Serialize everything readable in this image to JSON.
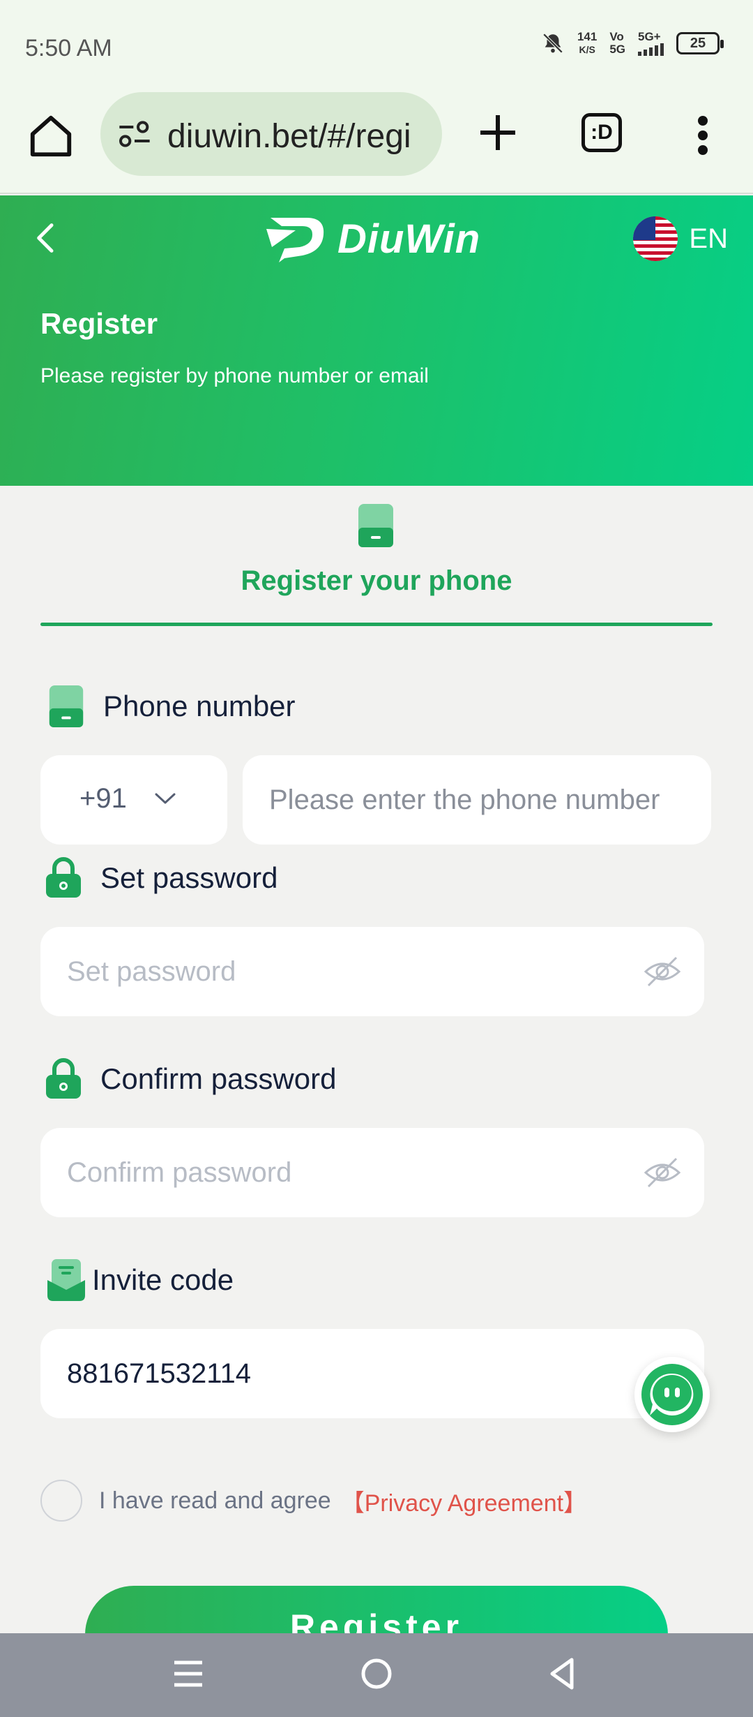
{
  "status_bar": {
    "time": "5:50 AM",
    "net_speed_value": "141",
    "net_speed_unit": "K/S",
    "signal_top": "Vo",
    "signal_bottom": "5G",
    "network_type": "5G+",
    "battery": "25"
  },
  "browser": {
    "url": "diuwin.bet/#/regi",
    "tabs_label": ":D"
  },
  "header": {
    "brand": "DiuWin",
    "language": "EN",
    "title": "Register",
    "subtitle": "Please register by phone number or email"
  },
  "tab": {
    "label": "Register your phone"
  },
  "form": {
    "phone_label": "Phone number",
    "country_code": "+91",
    "phone_placeholder": "Please enter the phone number",
    "password_label": "Set password",
    "password_placeholder": "Set password",
    "confirm_label": "Confirm password",
    "confirm_placeholder": "Confirm password",
    "invite_label": "Invite code",
    "invite_value": "881671532114"
  },
  "agreement": {
    "text": "I have read and agree",
    "link": "【Privacy Agreement】"
  },
  "register_button": "Register",
  "colors": {
    "brand_green": "#1fa55b",
    "gradient_start": "#2fae52",
    "gradient_end": "#06cf86",
    "link_red": "#e0534a"
  }
}
